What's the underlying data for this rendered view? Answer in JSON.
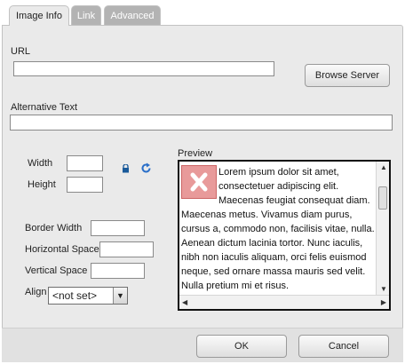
{
  "tabs": [
    {
      "label": "Image Info",
      "active": true
    },
    {
      "label": "Link",
      "active": false
    },
    {
      "label": "Advanced",
      "active": false
    }
  ],
  "form": {
    "url_label": "URL",
    "url_value": "",
    "browse_server": "Browse Server",
    "alt_label": "Alternative Text",
    "alt_value": "",
    "width_label": "Width",
    "width_value": "",
    "height_label": "Height",
    "height_value": "",
    "border_width_label": "Border Width",
    "border_width_value": "",
    "hspace_label": "Horizontal Space",
    "hspace_value": "",
    "vspace_label": "Vertical Space",
    "vspace_value": "",
    "align_label": "Align",
    "align_value": "<not set>"
  },
  "preview": {
    "label": "Preview",
    "text": "Lorem ipsum dolor sit amet, consectetuer adipiscing elit. Maecenas feugiat consequat diam. Maecenas metus. Vivamus diam purus, cursus a, commodo non, facilisis vitae, nulla. Aenean dictum lacinia tortor. Nunc iaculis, nibh non iaculis aliquam, orci felis euismod neque, sed ornare massa mauris sed velit. Nulla pretium mi et risus."
  },
  "footer": {
    "ok": "OK",
    "cancel": "Cancel"
  },
  "icons": {
    "lock": "lock-icon",
    "reset": "reset-size-icon",
    "broken_image": "broken-image-icon"
  },
  "colors": {
    "panel_bg": "#eaeaea",
    "tab_inactive_bg": "#b3b3b3",
    "lock_color": "#1a5a9a",
    "reset_color": "#2a6fc9",
    "broken_image_bg": "#e89a9a"
  }
}
